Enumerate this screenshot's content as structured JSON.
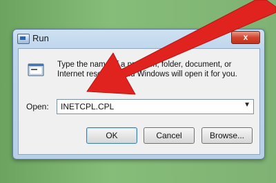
{
  "window": {
    "title": "Run",
    "close_glyph": "x"
  },
  "dialog": {
    "description": "Type the name of a program, folder, document, or Internet resource, and Windows will open it for you.",
    "open_label": "Open:",
    "open_value": "INETCPL.CPL",
    "dropdown_glyph": "▼"
  },
  "buttons": {
    "ok": "OK",
    "cancel": "Cancel",
    "browse": "Browse..."
  },
  "colors": {
    "arrow": "#e0231f",
    "background": "#7fb574"
  },
  "icons": [
    "run-window-icon",
    "close-icon",
    "run-program-icon",
    "dropdown-arrow-icon",
    "red-pointer-arrow"
  ]
}
